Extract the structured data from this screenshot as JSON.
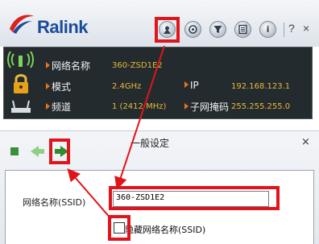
{
  "header": {
    "brand": "Ralink",
    "buttons": {
      "profile_icon": "profile-icon",
      "network_icon": "network-icon",
      "filter_icon": "filter-icon",
      "list_icon": "list-icon",
      "about_label": "i",
      "help_label": "?",
      "close_label": "×"
    }
  },
  "status": {
    "rows": [
      {
        "label": "网络名称",
        "value": "360-ZSD1E2"
      },
      {
        "label": "模式",
        "value": "2.4GHz"
      },
      {
        "label": "频道",
        "value": "1 (2412 MHz)"
      }
    ],
    "ip": {
      "label": "IP",
      "value": "192.168.123.1"
    },
    "mask": {
      "label": "子网掩码",
      "value": "255.255.255.0"
    }
  },
  "settings": {
    "title": "一般设定",
    "close_label": "×",
    "ssid_label": "网络名称(SSID)",
    "ssid_value": "360-ZSD1E2",
    "hide_ssid_label": "隐藏网络名称(SSID)",
    "hide_ssid_checked": false
  },
  "colors": {
    "highlight": "#e0151b",
    "brand": "#1a4b9b",
    "label_accent": "#e8731a",
    "value_text": "#e8b93a",
    "panel_bg": "#232b2e"
  }
}
